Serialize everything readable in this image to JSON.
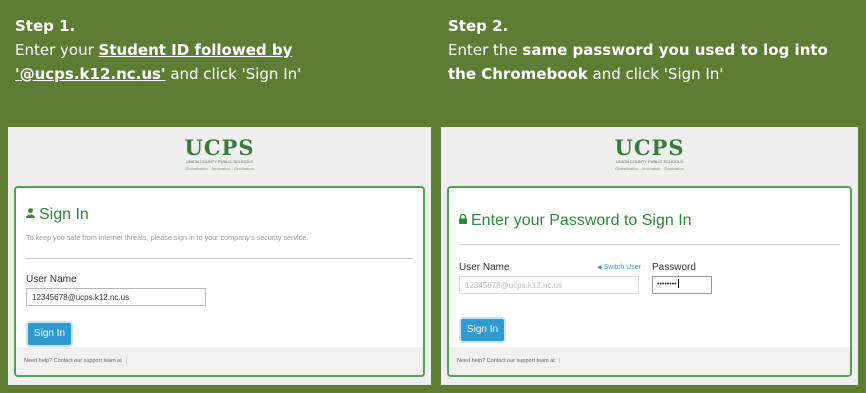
{
  "step1": {
    "title": "Step 1.",
    "text_pre": "Enter your ",
    "text_underlined": "Student ID followed by '@ucps.k12.nc.us'",
    "text_post": " and click 'Sign In'"
  },
  "step2": {
    "title": "Step 2.",
    "text_pre": "Enter the ",
    "text_bold": "same password you used to log into the Chromebook",
    "text_post": " and click 'Sign In'"
  },
  "logo": {
    "main": "UCPS",
    "sub": "UNION COUNTY PUBLIC SCHOOLS",
    "tag": "Globalization · Innovation · Graduation"
  },
  "signin1": {
    "icon": "user-icon",
    "title": "Sign In",
    "description": "To keep you safe from internet threats, please sign in to your company's security service.",
    "username_label": "User Name",
    "username_value": "12345678@ucps.k12.nc.us",
    "button_label": "Sign In",
    "help_text": "Need help? Contact our support team at"
  },
  "signin2": {
    "icon": "lock-icon",
    "title": "Enter your Password to Sign In",
    "username_label": "User Name",
    "switch_user": "Switch User",
    "username_value": "12345678@ucps.k12.nc.us",
    "password_label": "Password",
    "password_value": "••••••••",
    "button_label": "Sign In",
    "help_text": "Need help? Contact our support team at"
  },
  "colors": {
    "background": "#5e7d34",
    "accent_green": "#2a8a3a",
    "button_blue": "#2e9ad0"
  }
}
